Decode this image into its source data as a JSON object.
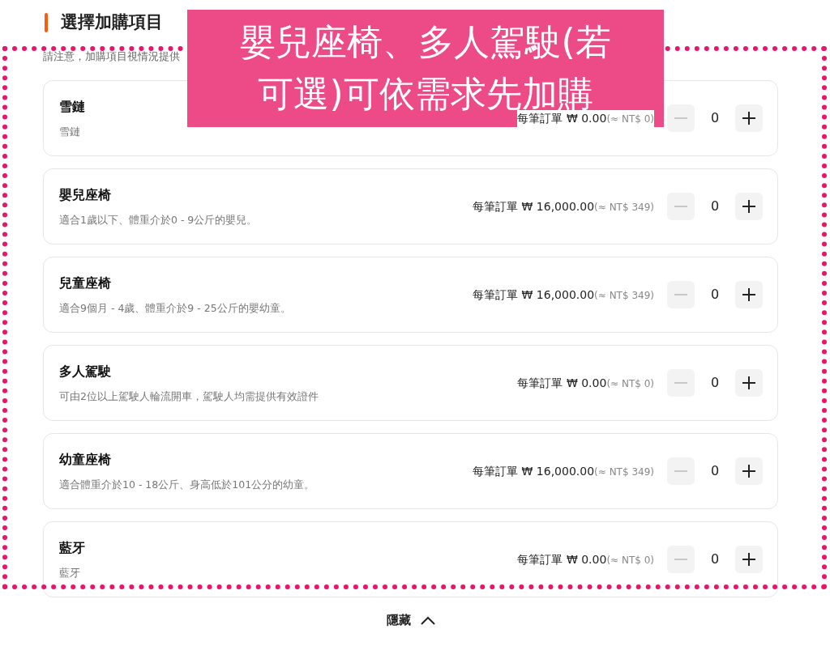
{
  "section": {
    "title": "選擇加購項目",
    "notice": "請注意，加購項目視情況提供"
  },
  "addons": [
    {
      "name": "雪鏈",
      "description": "雪鏈",
      "price": "每筆訂單 ₩ 0.00",
      "approx": "(≈ NT$ 0)",
      "quantity": "0",
      "decrease_disabled": true
    },
    {
      "name": "嬰兒座椅",
      "description": "適合1歲以下、體重介於0 - 9公斤的嬰兒。",
      "price": "每筆訂單 ₩ 16,000.00",
      "approx": "(≈ NT$ 349)",
      "quantity": "0",
      "decrease_disabled": true
    },
    {
      "name": "兒童座椅",
      "description": "適合9個月 - 4歲、體重介於9 - 25公斤的嬰幼童。",
      "price": "每筆訂單 ₩ 16,000.00",
      "approx": "(≈ NT$ 349)",
      "quantity": "0",
      "decrease_disabled": true
    },
    {
      "name": "多人駕駛",
      "description": "可由2位以上駕駛人輪流開車，駕駛人均需提供有效證件",
      "price": "每筆訂單 ₩ 0.00",
      "approx": "(≈ NT$ 0)",
      "quantity": "0",
      "decrease_disabled": true
    },
    {
      "name": "幼童座椅",
      "description": "適合體重介於10 - 18公斤、身高低於101公分的幼童。",
      "price": "每筆訂單 ₩ 16,000.00",
      "approx": "(≈ NT$ 349)",
      "quantity": "0",
      "decrease_disabled": true
    },
    {
      "name": "藍牙",
      "description": "藍牙",
      "price": "每筆訂單 ₩ 0.00",
      "approx": "(≈ NT$ 0)",
      "quantity": "0",
      "decrease_disabled": true
    }
  ],
  "toggle": {
    "label": "隱藏"
  },
  "annotation": {
    "lines": [
      "嬰兒座椅、多人駕駛(若",
      "可選)可依需求先加購"
    ]
  }
}
